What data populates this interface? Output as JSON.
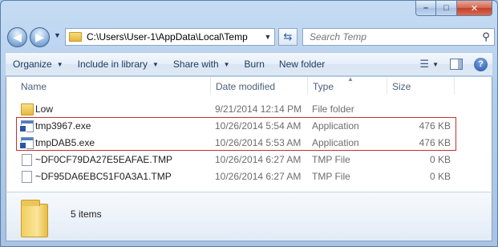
{
  "window": {
    "caption": {
      "minimize": "–",
      "maximize": "□",
      "close": "✕"
    }
  },
  "nav": {
    "back": "◀",
    "forward": "▶",
    "address": "C:\\Users\\User-1\\AppData\\Local\\Temp",
    "search_placeholder": "Search Temp"
  },
  "toolbar": {
    "organize": "Organize",
    "include_in_library": "Include in library",
    "share_with": "Share with",
    "burn": "Burn",
    "new_folder": "New folder"
  },
  "columns": {
    "name": "Name",
    "date_modified": "Date modified",
    "type": "Type",
    "size": "Size"
  },
  "files": [
    {
      "name": "Low",
      "date": "9/21/2014 12:14 PM",
      "type": "File folder",
      "size": "",
      "icon": "folder-icon"
    },
    {
      "name": "tmp3967.exe",
      "date": "10/26/2014 5:54 AM",
      "type": "Application",
      "size": "476 KB",
      "icon": "exe-icon"
    },
    {
      "name": "tmpDAB5.exe",
      "date": "10/26/2014 5:53 AM",
      "type": "Application",
      "size": "476 KB",
      "icon": "exe-icon"
    },
    {
      "name": "~DF0CF79DA27E5EAFAE.TMP",
      "date": "10/26/2014 6:27 AM",
      "type": "TMP File",
      "size": "0 KB",
      "icon": "file-icon"
    },
    {
      "name": "~DF95DA6EBC51F0A3A1.TMP",
      "date": "10/26/2014 6:27 AM",
      "type": "TMP File",
      "size": "0 KB",
      "icon": "file-icon"
    }
  ],
  "details": {
    "item_count": "5 items"
  },
  "colors": {
    "highlight": "#c53030",
    "toolbar_text": "#1e3a5f"
  }
}
